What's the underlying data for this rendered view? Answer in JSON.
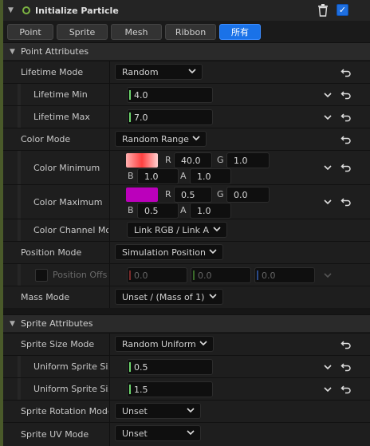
{
  "module": {
    "title": "Initialize Particle",
    "enabled_check": "✓"
  },
  "tabs": [
    "Point",
    "Sprite",
    "Mesh",
    "Ribbon",
    "所有"
  ],
  "point_section": {
    "label": "Point Attributes"
  },
  "lifetime_mode": {
    "label": "Lifetime Mode",
    "value": "Random"
  },
  "lifetime_min": {
    "label": "Lifetime Min",
    "value": "4.0"
  },
  "lifetime_max": {
    "label": "Lifetime Max",
    "value": "7.0"
  },
  "color_mode": {
    "label": "Color Mode",
    "value": "Random Range"
  },
  "color_min": {
    "label": "Color Minimum",
    "R": "40.0",
    "G": "1.0",
    "B": "1.0",
    "A": "1.0",
    "swatch": "#ff6060"
  },
  "color_max": {
    "label": "Color Maximum",
    "R": "0.5",
    "G": "0.0",
    "B": "0.5",
    "A": "1.0",
    "swatch": "#bb00bb"
  },
  "channel_labels": {
    "R": "R",
    "G": "G",
    "B": "B",
    "A": "A"
  },
  "color_channel_mode": {
    "label": "Color Channel Mo",
    "value": "Link RGB / Link A"
  },
  "position_mode": {
    "label": "Position Mode",
    "value": "Simulation Position"
  },
  "position_offset": {
    "label": "Position Offs",
    "x": "0.0",
    "y": "0.0",
    "z": "0.0"
  },
  "mass_mode": {
    "label": "Mass Mode",
    "value": "Unset / (Mass of 1)"
  },
  "sprite_section": {
    "label": "Sprite Attributes"
  },
  "sprite_size_mode": {
    "label": "Sprite Size Mode",
    "value": "Random Uniform"
  },
  "uniform_size_min": {
    "label": "Uniform Sprite Siz",
    "value": "0.5"
  },
  "uniform_size_max": {
    "label": "Uniform Sprite Siz",
    "value": "1.5"
  },
  "sprite_rotation_mode": {
    "label": "Sprite Rotation Mode",
    "value": "Unset"
  },
  "sprite_uv_mode": {
    "label": "Sprite UV Mode",
    "value": "Unset"
  }
}
